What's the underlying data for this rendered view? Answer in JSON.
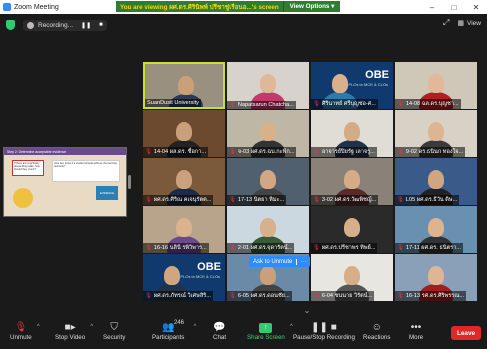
{
  "window": {
    "title": "Zoom Meeting",
    "controls": [
      "–",
      "□",
      "✕"
    ]
  },
  "share_banner": {
    "text": "You are viewing ผศ.ดร.ศิรินิพพ์ ปรีชาชู่เรือนอ...'s screen",
    "view_options": "View Options ▾"
  },
  "topbar": {
    "recording_label": "Recording...",
    "pause_glyph": "❚❚",
    "stop_glyph": "■",
    "view_label": "View"
  },
  "shared_slide": {
    "header": "Step 2: Determine acceptable evidence",
    "box1": "If there are cognitively demanding tasks, how should they count?",
    "box2": "How do I know if a student should achieve the learning outcome?",
    "evidence": "EVIDENCE"
  },
  "participants_tiles": [
    {
      "name": "SuanDusit University",
      "muted": false,
      "active": true,
      "bg": "#9a9080",
      "skin": "#c9a07a",
      "shirt": "#2b3a55"
    },
    {
      "name": "Napatsarun Chatcha...",
      "muted": true,
      "bg": "#d7d2cc",
      "skin": "#e0b896",
      "shirt": "#c03a6a"
    },
    {
      "name": "ศิรินาทย์ ศรีบุญช่อ-ศ...",
      "muted": true,
      "bg": "#103a6e",
      "obe": true,
      "skin": "#d9b08c",
      "shirt": "#2a7cb0"
    },
    {
      "name": "14-08 ฉล.ดร.บุญชา...",
      "muted": true,
      "bg": "#cfc7b8",
      "skin": "#e2b898",
      "shirt": "#b02020"
    },
    {
      "name": "14-04 ผล.ดร. ชื่อกา...",
      "muted": true,
      "bg": "#6b4a30",
      "skin": "#c9a07a",
      "shirt": "#222"
    },
    {
      "name": "จ-03 ผศ.ดร.ฉบ.กะพีก...",
      "muted": true,
      "bg": "#bfb7a6",
      "skin": "#d8b08a",
      "shirt": "#333"
    },
    {
      "name": "อาจารย์ปิยรัฐ เลาจรู...",
      "muted": true,
      "bg": "#e0ddd6",
      "skin": "#d4ab84",
      "shirt": "#22324a"
    },
    {
      "name": "9-02 ดร.ธนินก ทองใจ...",
      "muted": true,
      "bg": "#d8d2c6",
      "skin": "#deb592",
      "shirt": "#3a3a3a"
    },
    {
      "name": "ผศ.ดร.ศิริณ คเจนุรัตต...",
      "muted": true,
      "bg": "#7a5a3a",
      "skin": "#caa17a",
      "shirt": "#1f2a44"
    },
    {
      "name": "17-13 นิตยา หิมะ...",
      "muted": true,
      "bg": "#50606e",
      "skin": "#d2a884",
      "shirt": "#444"
    },
    {
      "name": "3-02 ผศ.ดร.วัฒพิชญ์...",
      "muted": true,
      "bg": "#8a8278",
      "skin": "#d5ac86",
      "shirt": "#5a2a2a"
    },
    {
      "name": "L05 ผศ.ดร.ธีวัน ดิษ...",
      "muted": true,
      "bg": "#3a5a8a",
      "skin": "#d0a680",
      "shirt": "#222"
    },
    {
      "name": "16-16 นลินี รพิวิพาร...",
      "muted": true,
      "bg": "#b8a48a",
      "skin": "#dab28e",
      "shirt": "#6a4a8a"
    },
    {
      "name": "2-01 ผศ.ดร.จุดารัตน์...",
      "muted": true,
      "bg": "#cbd8e0",
      "skin": "#d8b08c",
      "shirt": "#3a5a3a"
    },
    {
      "name": "ผศ.ดร.ปรีชาพร ทิพย์...",
      "muted": true,
      "bg": "#2a2a2a",
      "skin": "#d6ae8a",
      "shirt": "#2a2a2a"
    },
    {
      "name": "17-11 ผศ.ดร. ธนิตรา...",
      "muted": true,
      "bg": "#6a90b0",
      "skin": "#dcb490",
      "shirt": "#333"
    },
    {
      "name": "ผศ.ดร.ภัทรณ์ วิเศษสิริ...",
      "muted": true,
      "bg": "#103a6e",
      "obe": true,
      "skin": "#d0a680",
      "shirt": "#234"
    },
    {
      "name": "6-05 ผศ.ดร.ดอนชัย...",
      "muted": true,
      "bg": "#6a8aa8",
      "skin": "#c9a07a",
      "shirt": "#444"
    },
    {
      "name": "6-04 ชนนาย วิรัตน์...",
      "muted": true,
      "bg": "#e8e6e0",
      "skin": "#d8ae88",
      "shirt": "#555"
    },
    {
      "name": "16-13 รศ.ดร.ศิริพรรณ...",
      "muted": true,
      "bg": "#8aa0b8",
      "skin": "#deb694",
      "shirt": "#a02020"
    }
  ],
  "obe": {
    "title": "OBE",
    "sub": "FROM PLOs to MCE & CLOs"
  },
  "unmute_popup": {
    "label": "Ask to Unmute",
    "more": "···"
  },
  "toolbar": {
    "unmute": "Unmute",
    "stop_video": "Stop Video",
    "security": "Security",
    "participants": "Participants",
    "participants_count": "246",
    "chat": "Chat",
    "share_screen": "Share Screen",
    "pause_recording": "Pause/Stop Recording",
    "reactions": "Reactions",
    "more": "More",
    "leave": "Leave"
  },
  "colors": {
    "banner_bg": "#2e7d32",
    "banner_text": "#f5d90a",
    "leave_bg": "#e02828",
    "active_speaker": "#c6e02b",
    "share_green": "#2ecc71"
  }
}
